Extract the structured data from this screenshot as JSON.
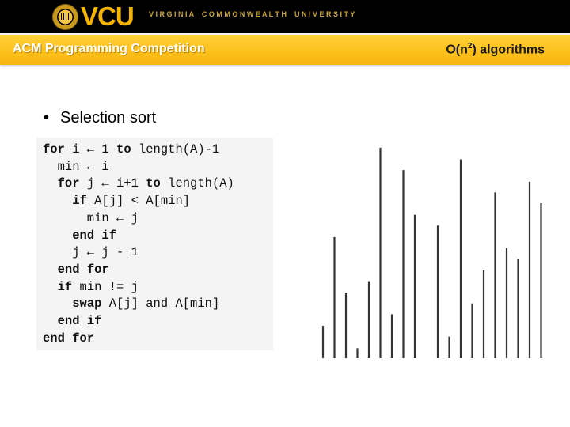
{
  "header": {
    "logo_text": "VCU",
    "university": "V I R G I N I A    C O M M O N W E A L T H    U N I V E R S I T Y",
    "title_left": "ACM Programming Competition",
    "title_right_base": "O(n",
    "title_right_sup": "2",
    "title_right_rest": ") algorithms",
    "brand_color": "#f5b400"
  },
  "content": {
    "bullet": "Selection sort",
    "code_lines": [
      [
        {
          "t": "for",
          "k": true
        },
        {
          "t": " i ← 1 "
        },
        {
          "t": "to",
          "k": true
        },
        {
          "t": " length(A)-1"
        }
      ],
      [
        {
          "t": "  min ← i"
        }
      ],
      [
        {
          "t": "  "
        },
        {
          "t": "for",
          "k": true
        },
        {
          "t": " j ← i+1 "
        },
        {
          "t": "to",
          "k": true
        },
        {
          "t": " length(A)"
        }
      ],
      [
        {
          "t": "    "
        },
        {
          "t": "if",
          "k": true
        },
        {
          "t": " A[j] < A[min]"
        }
      ],
      [
        {
          "t": "      min ← j"
        }
      ],
      [
        {
          "t": "    "
        },
        {
          "t": "end if",
          "k": true
        }
      ],
      [
        {
          "t": "    j ← j - 1"
        }
      ],
      [
        {
          "t": "  "
        },
        {
          "t": "end for",
          "k": true
        }
      ],
      [
        {
          "t": "  "
        },
        {
          "t": "if",
          "k": true
        },
        {
          "t": " min != j"
        }
      ],
      [
        {
          "t": "    "
        },
        {
          "t": "swap",
          "k": true
        },
        {
          "t": " A[j] and A[min]"
        }
      ],
      [
        {
          "t": "  "
        },
        {
          "t": "end if",
          "k": true
        }
      ],
      [
        {
          "t": "end for",
          "k": true
        }
      ]
    ]
  },
  "chart_data": {
    "type": "bar",
    "title": "",
    "xlabel": "",
    "ylabel": "",
    "description": "Unsorted array visualized as vertical lines (one slot empty)",
    "categories": [
      1,
      2,
      3,
      4,
      5,
      6,
      7,
      8,
      9,
      10,
      11,
      12,
      13,
      14,
      15,
      16,
      17,
      18,
      19,
      20
    ],
    "values": [
      42,
      157,
      85,
      13,
      100,
      273,
      57,
      244,
      186,
      0,
      172,
      28,
      258,
      71,
      114,
      215,
      143,
      129,
      229,
      201
    ],
    "ylim": [
      0,
      280
    ],
    "grid": false,
    "color": "#333333"
  }
}
